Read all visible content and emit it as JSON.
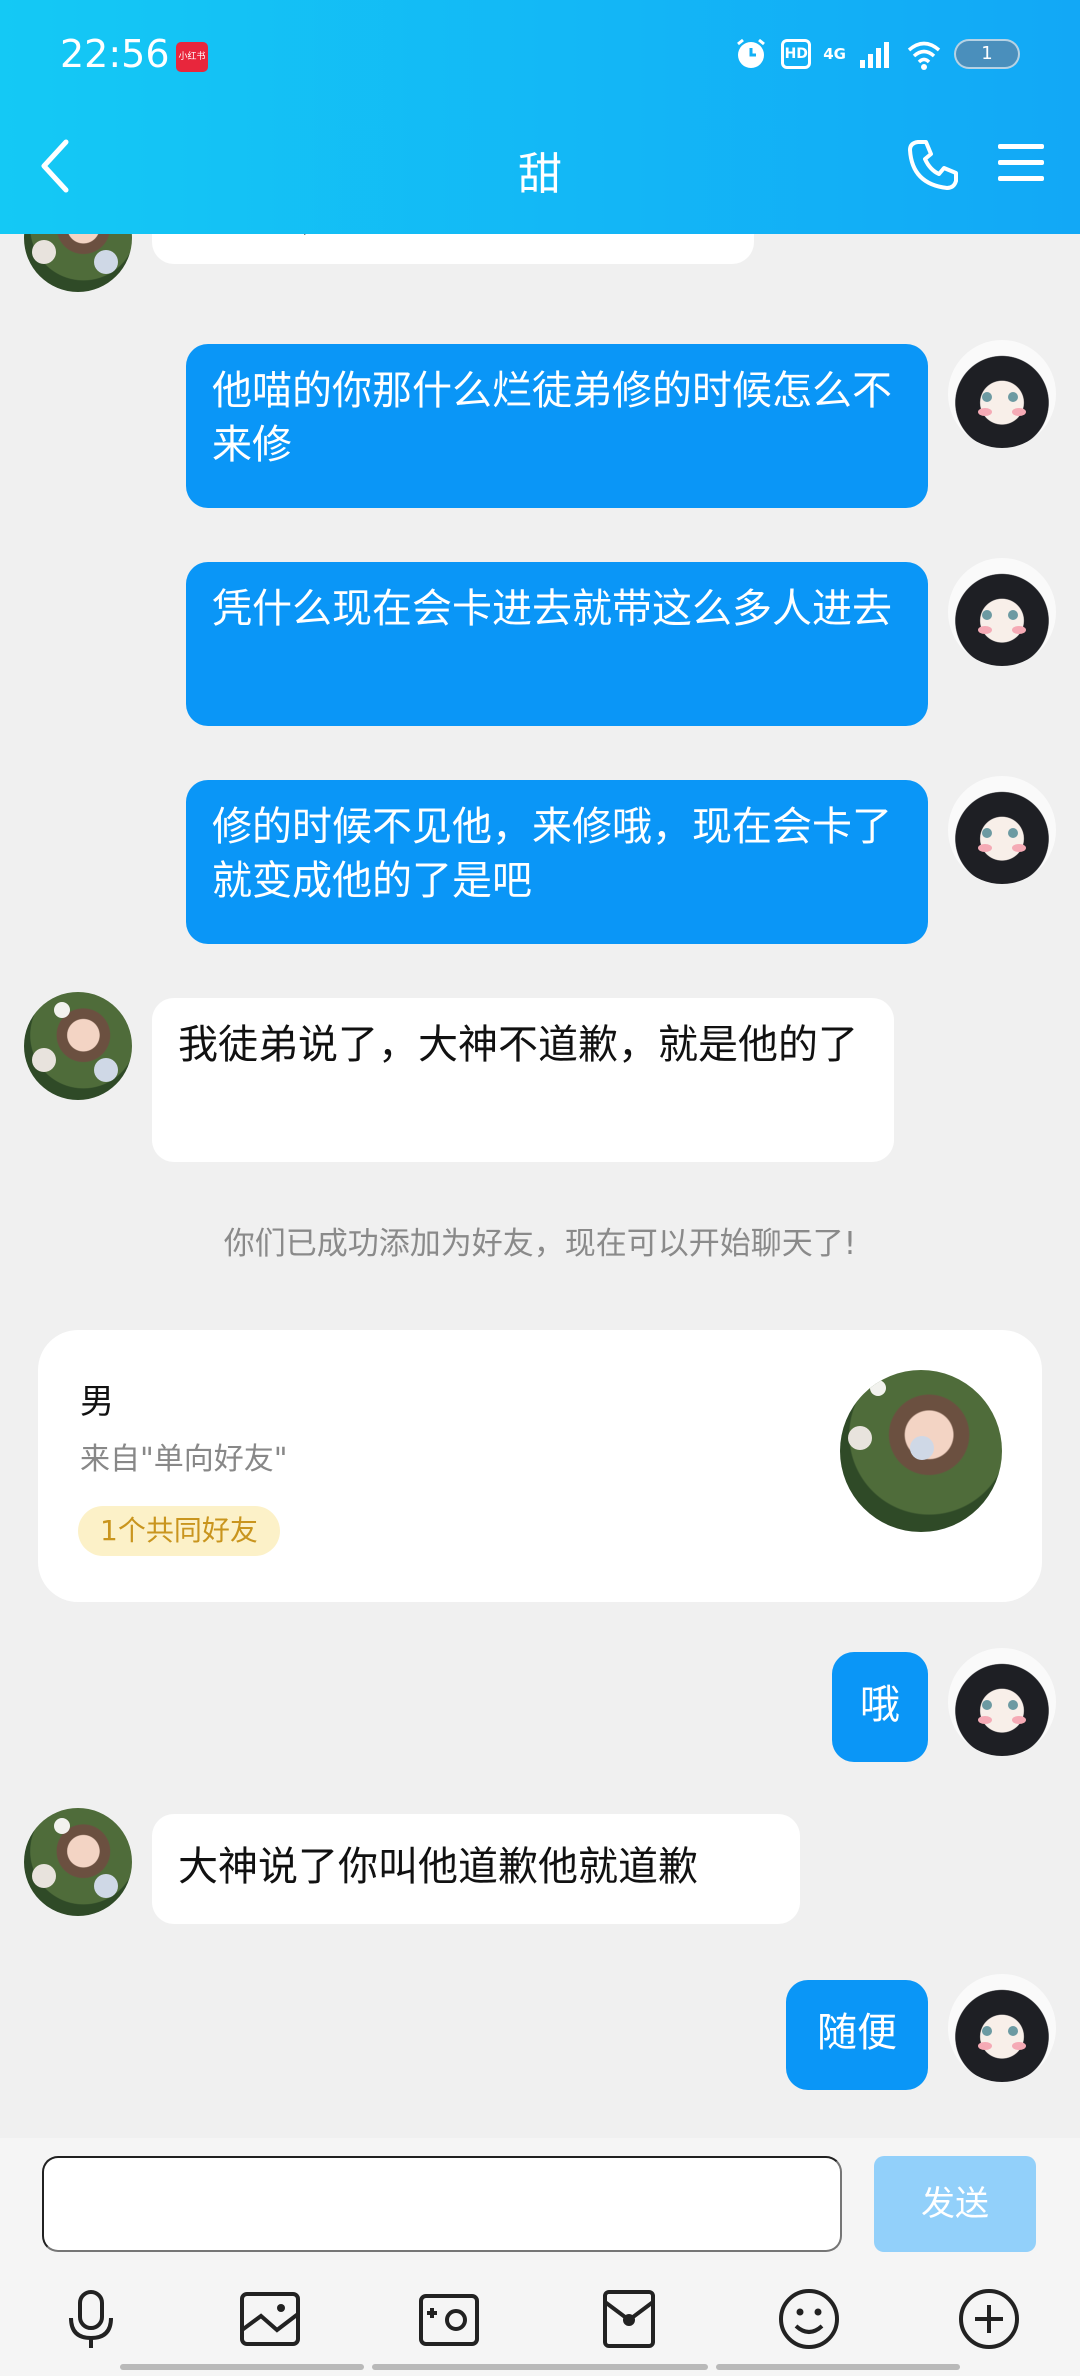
{
  "status_bar": {
    "time": "22:56",
    "app_badge": "小红书",
    "network": "4G",
    "hd": "HD",
    "battery": "1"
  },
  "header": {
    "title": "甜"
  },
  "messages": [
    {
      "side": "in",
      "text": "加好友，我要发这个给您看"
    },
    {
      "side": "out",
      "text": "他喵的你那什么烂徒弟修的时候怎么不来修"
    },
    {
      "side": "out",
      "text": "凭什么现在会卡进去就带这么多人进去"
    },
    {
      "side": "out",
      "text": "修的时候不见他，来修哦，现在会卡了就变成他的了是吧"
    },
    {
      "side": "in",
      "text": "我徒弟说了，大神不道歉，就是他的了"
    },
    {
      "side": "out",
      "text": "哦"
    },
    {
      "side": "in",
      "text": "大神说了你叫他道歉他就道歉"
    },
    {
      "side": "out",
      "text": "随便"
    }
  ],
  "system_notice": "你们已成功添加为好友，现在可以开始聊天了!",
  "friend_card": {
    "gender": "男",
    "source": "来自\"单向好友\"",
    "mutual": "1个共同好友"
  },
  "input": {
    "placeholder": "",
    "send_label": "发送"
  },
  "toolbar": {
    "icons": [
      "microphone-icon",
      "image-icon",
      "camera-icon",
      "red-packet-icon",
      "emoji-icon",
      "plus-icon"
    ]
  },
  "colors": {
    "header_start": "#14c9f5",
    "header_end": "#12a8f6",
    "outgoing_bubble": "#0a96f7",
    "send_button_disabled": "#92d0fa"
  }
}
